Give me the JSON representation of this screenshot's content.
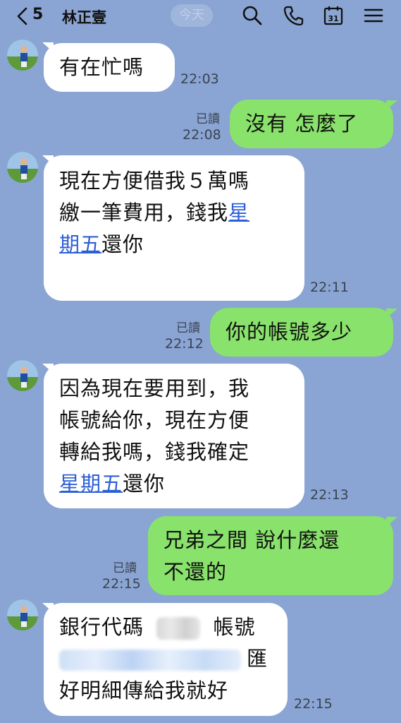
{
  "header": {
    "unread_count": "5",
    "contact_name": "林正壹",
    "date_pill": "今天",
    "calendar_day": "31"
  },
  "messages": [
    {
      "side": "in",
      "text": "有在忙嗎",
      "time": "22:03"
    },
    {
      "side": "out",
      "read": "已讀",
      "text": "沒有 怎麼了",
      "time": "22:08"
    },
    {
      "side": "in",
      "line1": "現在方便借我５萬嗎",
      "line2a": "繳一筆費用，錢我",
      "link_a": "星",
      "link_b": "期五",
      "line3": "還你",
      "time": "22:11"
    },
    {
      "side": "out",
      "read": "已讀",
      "text": "你的帳號多少",
      "time": "22:12"
    },
    {
      "side": "in",
      "line1": "因為現在要用到，我",
      "line2": "帳號給你，現在方便",
      "line3": "轉給我嗎，錢我確定",
      "link": "星期五",
      "line4": "還你",
      "time": "22:13"
    },
    {
      "side": "out",
      "read": "已讀",
      "line1": "兄弟之間 說什麼還",
      "line2": "不還的",
      "time": "22:15"
    },
    {
      "side": "in",
      "line1a": "銀行代碼",
      "line1b": "帳號",
      "line2": "匯",
      "line3": "好明細傳給我就好",
      "time": "22:15"
    }
  ],
  "colors": {
    "background": "#8aa5d3",
    "incoming": "#ffffff",
    "outgoing": "#89e26b",
    "link": "#2d5fd6"
  }
}
